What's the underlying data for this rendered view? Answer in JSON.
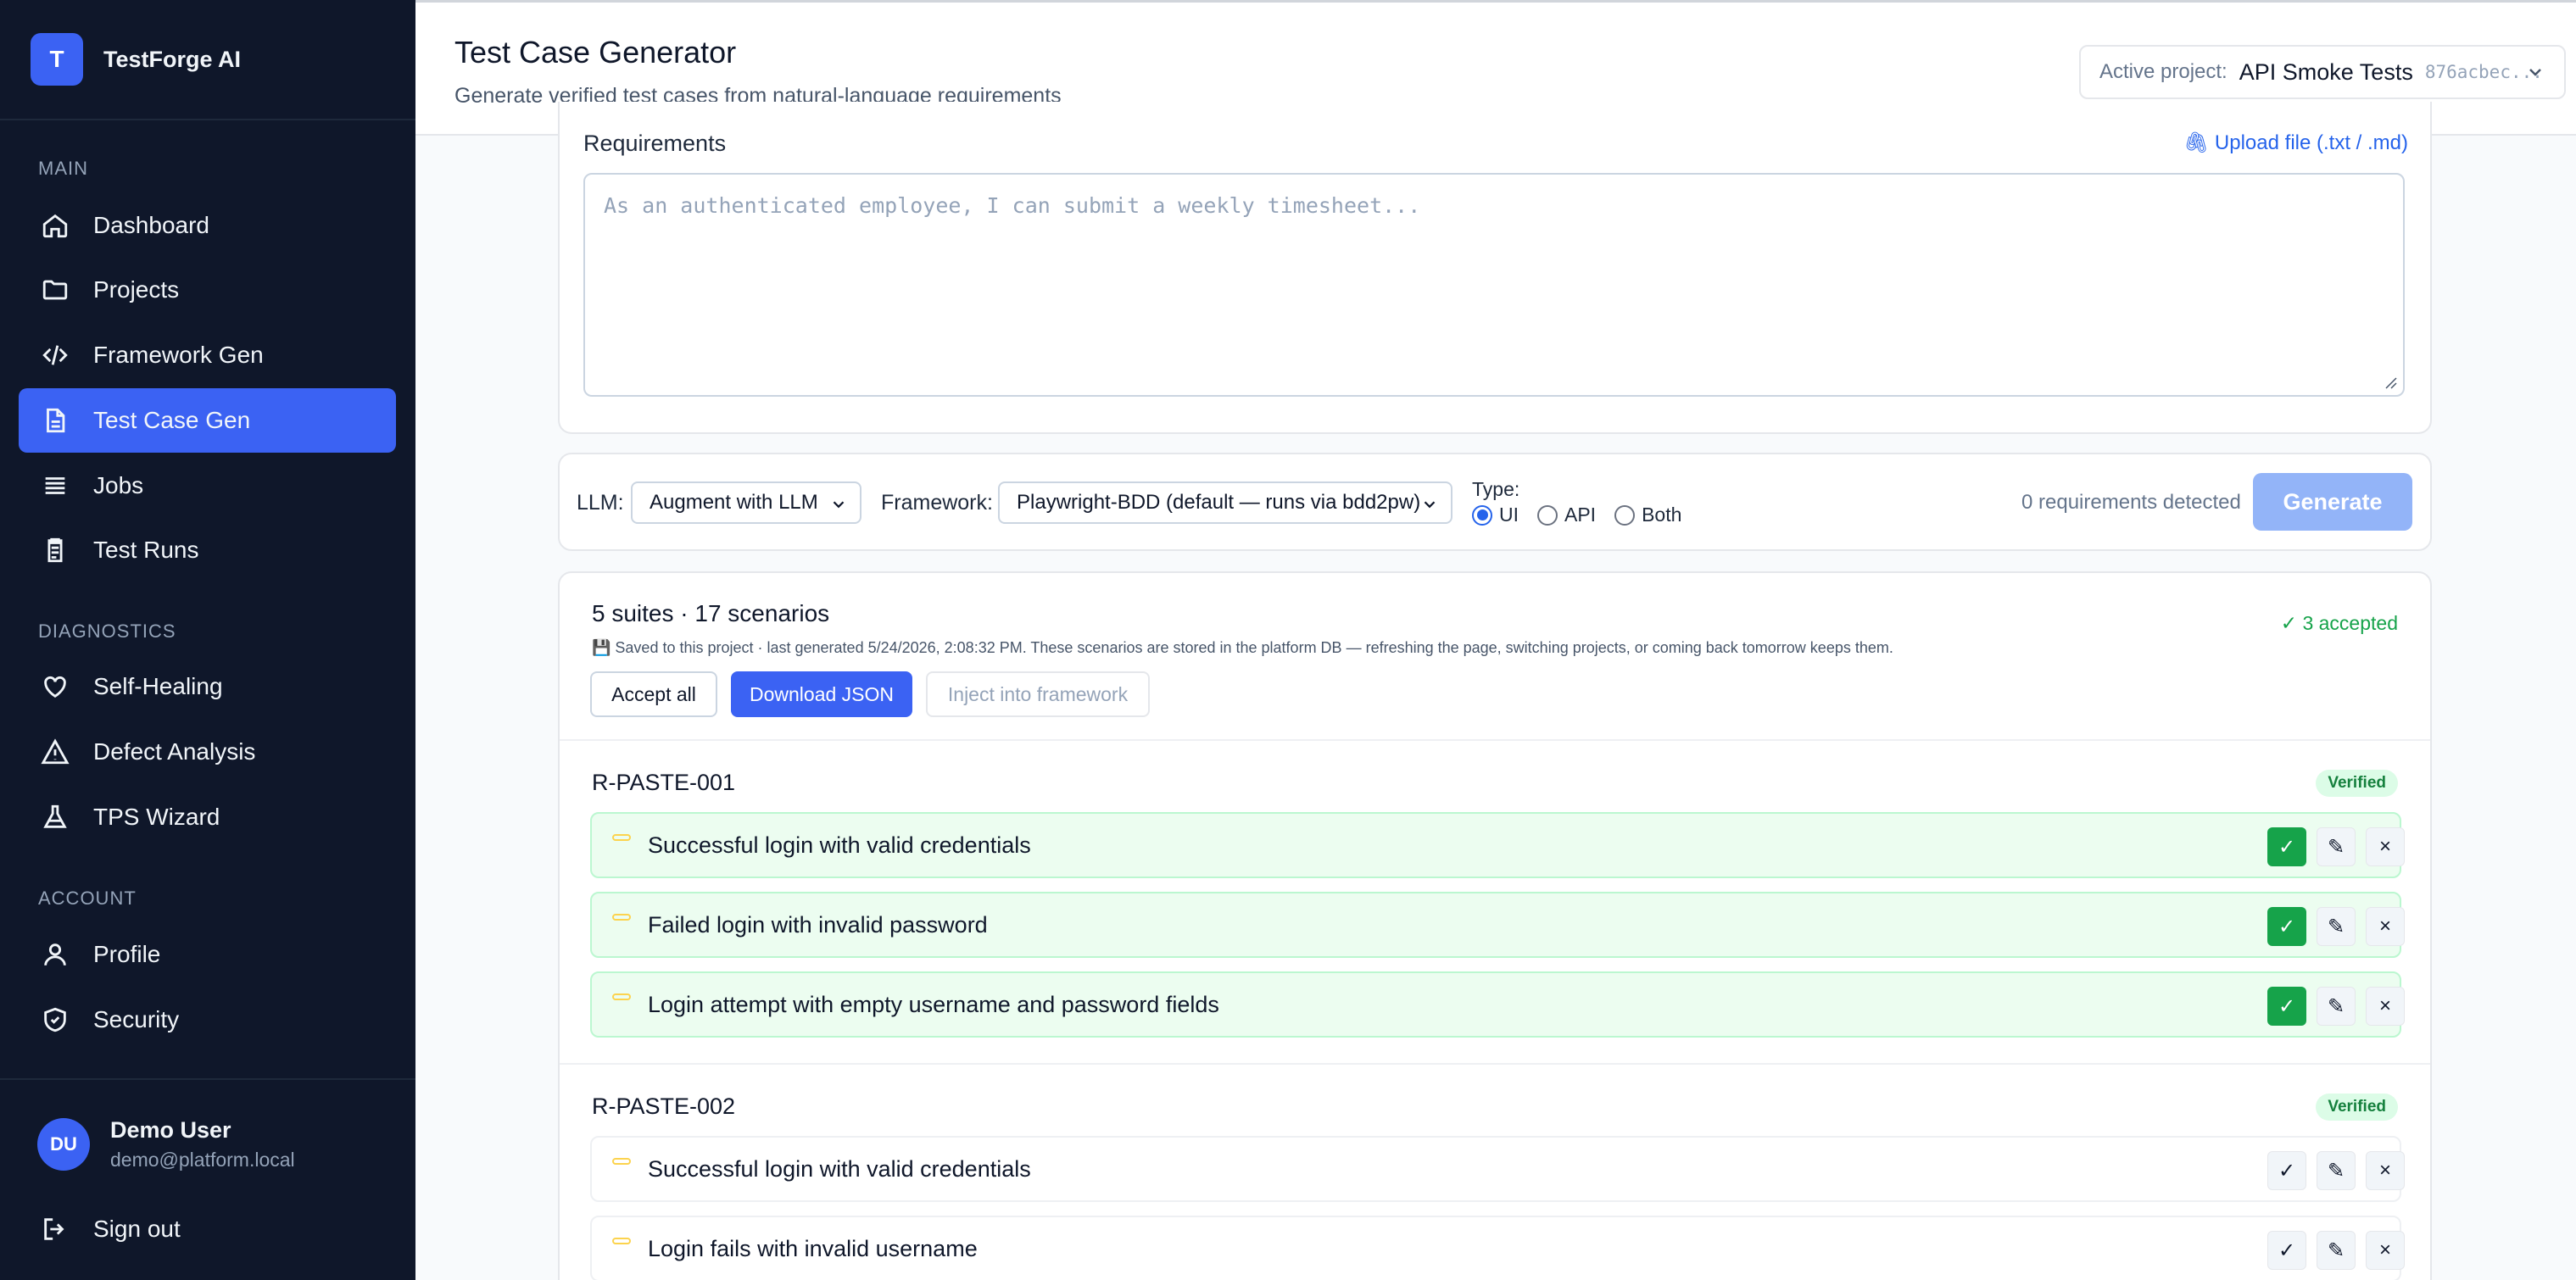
{
  "app": {
    "logo_letter": "T",
    "name": "TestForge AI"
  },
  "sidebar": {
    "sections": {
      "main": "MAIN",
      "diagnostics": "DIAGNOSTICS",
      "account": "ACCOUNT"
    },
    "items": [
      {
        "label": "Dashboard",
        "icon": "home-icon"
      },
      {
        "label": "Projects",
        "icon": "folder-icon"
      },
      {
        "label": "Framework Gen",
        "icon": "code-icon"
      },
      {
        "label": "Test Case Gen",
        "icon": "document-icon",
        "active": true
      },
      {
        "label": "Jobs",
        "icon": "list-icon"
      },
      {
        "label": "Test Runs",
        "icon": "clipboard-icon"
      },
      {
        "label": "Self-Healing",
        "icon": "heart-icon"
      },
      {
        "label": "Defect Analysis",
        "icon": "warning-icon"
      },
      {
        "label": "TPS Wizard",
        "icon": "flask-icon"
      },
      {
        "label": "Profile",
        "icon": "user-icon"
      },
      {
        "label": "Security",
        "icon": "shield-icon"
      }
    ],
    "user": {
      "initials": "DU",
      "name": "Demo User",
      "email": "demo@platform.local"
    },
    "sign_out": "Sign out"
  },
  "header": {
    "title": "Test Case Generator",
    "subtitle": "Generate verified test cases from natural-language requirements",
    "project_label": "Active project:",
    "project_name": "API Smoke Tests",
    "project_id": "876acbec..."
  },
  "requirements": {
    "label": "Requirements",
    "upload": "Upload file (.txt / .md)",
    "placeholder": "As an authenticated employee, I can submit a weekly timesheet..."
  },
  "controls": {
    "llm_label": "LLM:",
    "llm_value": "Augment with LLM",
    "framework_label": "Framework:",
    "framework_value": "Playwright-BDD (default — runs via bdd2pw)",
    "type_label": "Type:",
    "type_options": [
      "UI",
      "API",
      "Both"
    ],
    "type_selected": "UI",
    "detected": "0 requirements detected",
    "generate": "Generate"
  },
  "results": {
    "summary": "5 suites · 17 scenarios",
    "saved_note": "💾 Saved to this project · last generated 5/24/2026, 2:08:32 PM. These scenarios are stored in the platform DB — refreshing the page, switching projects, or coming back tomorrow keeps them.",
    "accepted": "✓ 3 accepted",
    "accept_all": "Accept all",
    "download": "Download JSON",
    "inject": "Inject into framework",
    "suites": [
      {
        "id": "R-PASTE-001",
        "badge": "Verified",
        "scenarios": [
          {
            "title": "Successful login with valid credentials",
            "accepted": true
          },
          {
            "title": "Failed login with invalid password",
            "accepted": true
          },
          {
            "title": "Login attempt with empty username and password fields",
            "accepted": true
          }
        ]
      },
      {
        "id": "R-PASTE-002",
        "badge": "Verified",
        "scenarios": [
          {
            "title": "Successful login with valid credentials",
            "accepted": false
          },
          {
            "title": "Login fails with invalid username",
            "accepted": false
          }
        ]
      }
    ],
    "actions": {
      "accept": "✓",
      "edit": "✎",
      "delete": "×"
    }
  }
}
